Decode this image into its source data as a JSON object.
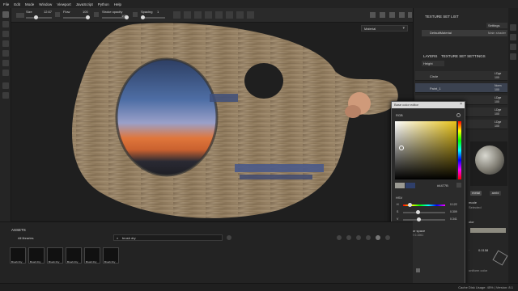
{
  "menu": [
    "File",
    "Edit",
    "Mode",
    "Window",
    "Viewport",
    "JavaScript",
    "Python",
    "Help"
  ],
  "toolbar": {
    "size_label": "Size",
    "size_value": "12.67",
    "flow_label": "Flow",
    "flow_value": "100",
    "stroke_opacity_label": "Stroke opacity",
    "stroke_opacity_value": "100",
    "spacing_label": "Spacing",
    "spacing_value": "1"
  },
  "viewport": {
    "display_mode": "Material"
  },
  "texture_set_list": {
    "title": "TEXTURE SET LIST",
    "settings": "Settings",
    "item": "DefaultMaterial",
    "shader": "Main shader"
  },
  "layers": {
    "tab_layers": "LAYERS",
    "tab_settings": "TEXTURE SET SETTINGS",
    "channel": "Height",
    "rows": [
      {
        "name": "Circle",
        "blend": "LDge",
        "opacity": "100"
      },
      {
        "name": "Paint_1",
        "blend": "Norm",
        "opacity": "100"
      },
      {
        "name": "",
        "blend": "LDge",
        "opacity": "100"
      },
      {
        "name": "",
        "blend": "LDge",
        "opacity": "100"
      },
      {
        "name": "",
        "blend": "LDge",
        "opacity": "100"
      }
    ]
  },
  "properties": {
    "tabs": [
      "metal",
      "ambi"
    ],
    "mode_label": "mode",
    "selected": "Selected",
    "color_label": "olor",
    "uniform_color": "uniform color",
    "value": "0.0158"
  },
  "color_picker": {
    "title": "Base color editor",
    "mode": "RGB",
    "hex": "#4477B",
    "hsv_label": "HSV",
    "rows": [
      {
        "label": "H",
        "value": "0.122"
      },
      {
        "label": "S",
        "value": "0.309"
      },
      {
        "label": "V",
        "value": "0.341"
      }
    ],
    "working_space_label": "Working color space",
    "working_space_value": "0.2341   0.2412   0.1061",
    "swatches_label": "Swatches",
    "add_swatch": "+"
  },
  "assets": {
    "title": "ASSETS",
    "library": "All libraries",
    "search_value": "brush dry",
    "items": [
      "Brush Dry",
      "Brush Dry",
      "Brush Dry",
      "Brush Dry",
      "Brush Dry",
      "Brush Dry"
    ]
  },
  "status": {
    "cache": "Cache Disk Usage:  45%  |  Version: 8.1"
  },
  "colors": {
    "accent": "#3a8fd6",
    "picked": "#9b9a93",
    "wood": "#8d7a60"
  }
}
